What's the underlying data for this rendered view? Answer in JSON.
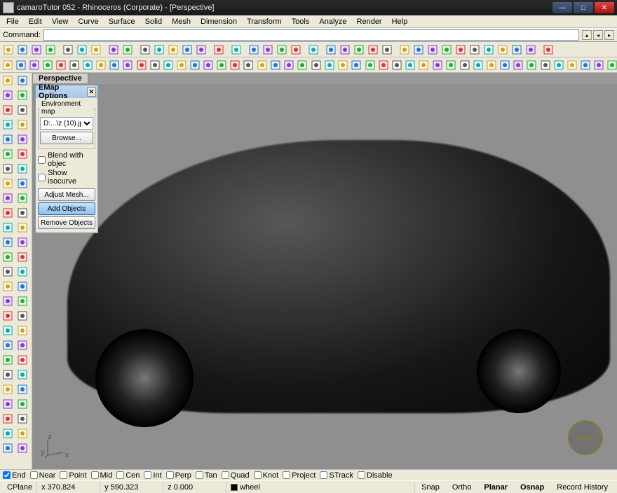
{
  "window": {
    "title": "camaroTutor 052 - Rhinoceros (Corporate) - [Perspective]"
  },
  "menu": [
    "File",
    "Edit",
    "View",
    "Curve",
    "Surface",
    "Solid",
    "Mesh",
    "Dimension",
    "Transform",
    "Tools",
    "Analyze",
    "Render",
    "Help"
  ],
  "command": {
    "label": "Command:",
    "value": ""
  },
  "viewport": {
    "title": "Perspective"
  },
  "emap": {
    "title": "EMap Options",
    "groupLabel": "Environment map",
    "fileValue": "D:...\\z (10).jpg",
    "browse": "Browse...",
    "blend": "Blend with objec",
    "showIso": "Show isocurve",
    "adjustMesh": "Adjust Mesh...",
    "addObjects": "Add Objects",
    "removeObjects": "Remove Objects"
  },
  "osnap": {
    "items": [
      {
        "label": "End",
        "checked": true
      },
      {
        "label": "Near",
        "checked": false
      },
      {
        "label": "Point",
        "checked": false
      },
      {
        "label": "Mid",
        "checked": false
      },
      {
        "label": "Cen",
        "checked": false
      },
      {
        "label": "Int",
        "checked": false
      },
      {
        "label": "Perp",
        "checked": false
      },
      {
        "label": "Tan",
        "checked": false
      },
      {
        "label": "Quad",
        "checked": false
      },
      {
        "label": "Knot",
        "checked": false
      },
      {
        "label": "Project",
        "checked": false
      },
      {
        "label": "STrack",
        "checked": false
      },
      {
        "label": "Disable",
        "checked": false
      }
    ]
  },
  "status": {
    "cplane": "CPlane",
    "x": "x 370.824",
    "y": "y 590.323",
    "z": "z 0.000",
    "layer": "wheel",
    "buttons": [
      "Snap",
      "Ortho",
      "Planar",
      "Osnap",
      "Record History"
    ],
    "active": [
      "Planar",
      "Osnap"
    ]
  },
  "logo": "korg",
  "topToolbarIcons1": [
    "new",
    "open",
    "save",
    "print",
    "sep",
    "cut",
    "copy",
    "paste",
    "sep",
    "undo",
    "redo",
    "sep",
    "pan",
    "rot",
    "zoom",
    "zoom-ext",
    "zoom-win",
    "sep",
    "mag",
    "sep",
    "layer",
    "sep",
    "hide",
    "show",
    "lock",
    "unlock",
    "sep",
    "options",
    "sep",
    "render",
    "shade",
    "wireframe",
    "ghost",
    "xray",
    "sep",
    "pt1",
    "pt2",
    "pt3",
    "pt4",
    "line",
    "poly",
    "rect",
    "circle",
    "arc",
    "ellipse",
    "sep",
    "help"
  ],
  "topToolbarIcons2": [
    "box",
    "sphere",
    "cyl",
    "cone",
    "torus",
    "pipe",
    "tube",
    "pyramid",
    "ellipsoid",
    "paraboloid",
    "sep",
    "extrude",
    "loft",
    "sweep1",
    "sweep2",
    "revolve",
    "rail",
    "blend",
    "patch",
    "network",
    "sep",
    "offset",
    "fillet",
    "chamfer",
    "cap",
    "sep",
    "boolean-u",
    "boolean-d",
    "boolean-i",
    "boolean-s",
    "sep",
    "explode",
    "join",
    "trim",
    "split",
    "extend",
    "sep",
    "group",
    "ungroup",
    "sep",
    "array",
    "mirror",
    "rotate",
    "scale",
    "move",
    "align",
    "sep",
    "analyze",
    "measure",
    "area",
    "volume",
    "mass",
    "check"
  ],
  "leftToolbarIcons": [
    "point",
    "points",
    "line",
    "polyline",
    "rect",
    "polygon",
    "circle",
    "arc",
    "ellipse",
    "curve",
    "interp",
    "sketch",
    "helix",
    "spiral",
    "extend",
    "fillet",
    "chamfer",
    "offset",
    "blend",
    "match",
    "project",
    "pull",
    "intersect",
    "contour",
    "section",
    "silhouette",
    "extract",
    "dup",
    "rebuild",
    "fair",
    "edit-pt",
    "control-pt",
    "insert-pt",
    "remove-pt",
    "kink",
    "handlebar",
    "simplify",
    "periodic",
    "change-deg",
    "adjust",
    "cage",
    "flow",
    "bend",
    "twist",
    "taper",
    "stretch",
    "smooth",
    "orient",
    "remap",
    "split",
    "trim",
    "extend2"
  ]
}
